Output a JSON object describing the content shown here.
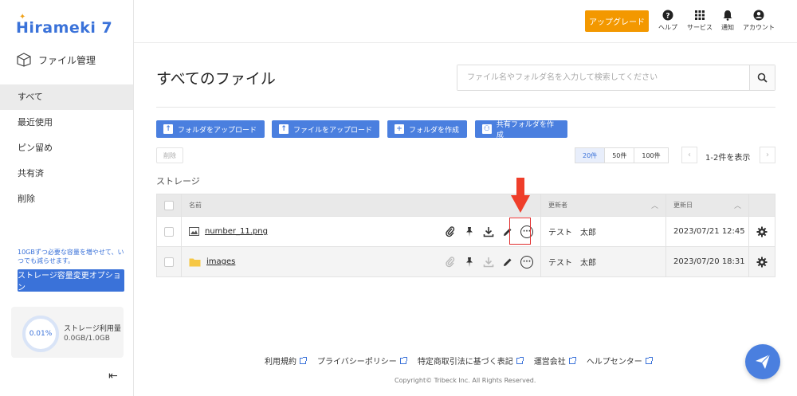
{
  "brand": {
    "logo_text": "Hirameki 7",
    "accent": "#3a72d9",
    "upgrade_color": "#f39800"
  },
  "sidebar": {
    "section_title": "ファイル管理",
    "items": [
      {
        "label": "すべて",
        "active": true
      },
      {
        "label": "最近使用",
        "active": false
      },
      {
        "label": "ピン留め",
        "active": false
      },
      {
        "label": "共有済",
        "active": false
      },
      {
        "label": "削除",
        "active": false
      }
    ],
    "promo_text": "10GBずつ必要な容量を増やせて、いつでも減らせます。",
    "promo_button": "ストレージ容量変更オプション",
    "storage": {
      "percent": "0.01%",
      "label": "ストレージ利用量",
      "value": "0.0GB/1.0GB"
    }
  },
  "topbar": {
    "upgrade": "アップグレード",
    "icons": [
      {
        "name": "help-icon",
        "label": "ヘルプ"
      },
      {
        "name": "services-grid-icon",
        "label": "サービス"
      },
      {
        "name": "bell-icon",
        "label": "通知"
      },
      {
        "name": "account-icon",
        "label": "アカウント"
      }
    ]
  },
  "main": {
    "title": "すべてのファイル",
    "search_placeholder": "ファイル名やフォルダ名を入力して検索してください",
    "actions": {
      "upload_folder": "フォルダをアップロード",
      "upload_file": "ファイルをアップロード",
      "create_folder": "フォルダを作成",
      "create_shared": "共有フォルダを作成"
    },
    "delete_label": "削除",
    "page_sizes": [
      "20件",
      "50件",
      "100件"
    ],
    "page_count": "1-2件を表示",
    "storage_title": "ストレージ"
  },
  "table": {
    "headers": {
      "name": "名前",
      "updater": "更新者",
      "date": "更新日"
    },
    "rows": [
      {
        "name": "number_11.png",
        "type": "image",
        "updater": "テスト　太郎",
        "date": "2023/07/21 12:45"
      },
      {
        "name": "images",
        "type": "folder",
        "updater": "テスト　太郎",
        "date": "2023/07/20 18:31"
      }
    ]
  },
  "footer": {
    "links": [
      "利用規約",
      "プライバシーポリシー",
      "特定商取引法に基づく表記",
      "運営会社",
      "ヘルプセンター"
    ],
    "copyright": "Copyright© Tribeck Inc. All Rights Reserved."
  }
}
